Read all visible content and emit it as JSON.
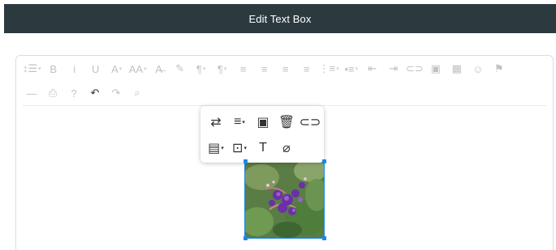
{
  "window": {
    "title": "Edit Text Box"
  },
  "toolbar": {
    "row1": [
      {
        "name": "line-height-icon",
        "glyph": "↕☰",
        "caret": true
      },
      {
        "name": "bold-icon",
        "glyph": "B"
      },
      {
        "name": "italic-icon",
        "glyph": "i"
      },
      {
        "name": "underline-icon",
        "glyph": "U"
      },
      {
        "name": "font-color-icon",
        "glyph": "A",
        "caret": true
      },
      {
        "name": "font-size-icon",
        "glyph": "AA",
        "caret": true
      },
      {
        "name": "clear-format-icon",
        "glyph": "A̶"
      },
      {
        "name": "highlight-icon",
        "glyph": "✎"
      },
      {
        "name": "paragraph-style-icon",
        "glyph": "¶",
        "caret": true
      },
      {
        "name": "paragraph-format-icon",
        "glyph": "¶",
        "caret": true
      },
      {
        "name": "align-left-icon",
        "glyph": "≡"
      },
      {
        "name": "align-center-icon",
        "glyph": "≡"
      },
      {
        "name": "align-right-icon",
        "glyph": "≡"
      },
      {
        "name": "align-justify-icon",
        "glyph": "≡"
      },
      {
        "name": "ordered-list-icon",
        "glyph": "⋮≡",
        "caret": true
      },
      {
        "name": "unordered-list-icon",
        "glyph": "•≡",
        "caret": true
      },
      {
        "name": "outdent-icon",
        "glyph": "⇤"
      },
      {
        "name": "indent-icon",
        "glyph": "⇥"
      },
      {
        "name": "link-icon",
        "glyph": "⊂⊃"
      },
      {
        "name": "image-icon",
        "glyph": "▣"
      },
      {
        "name": "table-icon",
        "glyph": "▦"
      },
      {
        "name": "emoji-icon",
        "glyph": "☺"
      },
      {
        "name": "flag-icon",
        "glyph": "⚑"
      }
    ],
    "row2": [
      {
        "name": "horizontal-line-icon",
        "glyph": "—"
      },
      {
        "name": "print-icon",
        "glyph": "⎙"
      },
      {
        "name": "help-icon",
        "glyph": "?"
      },
      {
        "name": "undo-icon",
        "glyph": "↶",
        "dark": true
      },
      {
        "name": "redo-icon",
        "glyph": "↷"
      },
      {
        "name": "find-replace-icon",
        "glyph": "⌕"
      }
    ]
  },
  "image_popup": {
    "row1": [
      {
        "name": "replace-icon",
        "glyph": "⇄"
      },
      {
        "name": "align-image-icon",
        "glyph": "≡",
        "caret": true
      },
      {
        "name": "image-caption-icon",
        "glyph": "▣"
      },
      {
        "name": "delete-icon",
        "glyph": "🗑"
      },
      {
        "name": "insert-link-icon",
        "glyph": "⊂⊃"
      }
    ],
    "row2": [
      {
        "name": "display-icon",
        "glyph": "▤",
        "caret": true
      },
      {
        "name": "image-style-icon",
        "glyph": "⊡",
        "caret": true
      },
      {
        "name": "alt-text-icon",
        "glyph": "T"
      },
      {
        "name": "resize-icon",
        "glyph": "⌀"
      }
    ]
  },
  "colors": {
    "header_bg": "#2c3a3f",
    "selection": "#1e88e5",
    "toolbar_icon_disabled": "#c2c2c2"
  }
}
